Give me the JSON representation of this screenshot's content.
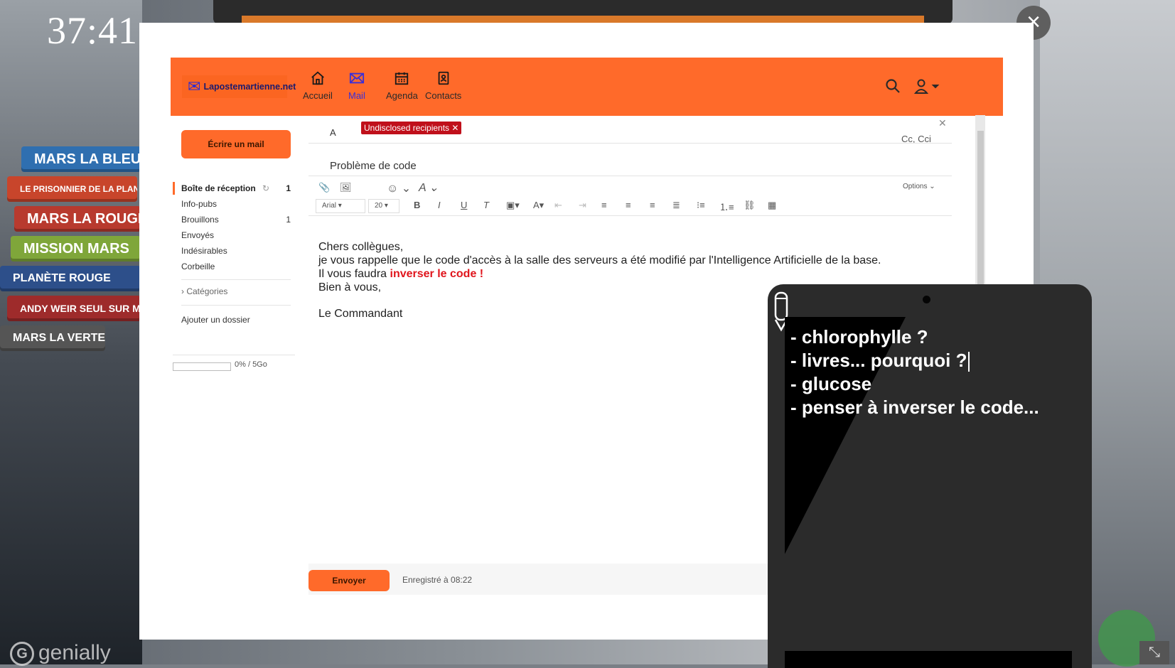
{
  "timer": "37:41",
  "close_label": "×",
  "background": {
    "books": [
      "MARS LA BLEUE",
      "LE PRISONNIER DE LA PLANÈTE MARS",
      "MARS LA ROUGE",
      "MISSION MARS",
      "PLANÈTE ROUGE",
      "ANDY WEIR SEUL SUR MARS",
      "MARS LA VERTE"
    ],
    "watermark": "genially"
  },
  "header": {
    "logo_text": "Lapostemartienne.net",
    "nav": [
      {
        "label": "Accueil",
        "icon": "home-icon"
      },
      {
        "label": "Mail",
        "icon": "mail-icon"
      },
      {
        "label": "Agenda",
        "icon": "calendar-icon"
      },
      {
        "label": "Contacts",
        "icon": "contacts-icon"
      }
    ],
    "accent": "#ff6a2a"
  },
  "sidebar": {
    "compose_label": "Écrire un mail",
    "folders": [
      {
        "label": "Boîte de réception",
        "count": "1"
      },
      {
        "label": "Info-pubs",
        "count": ""
      },
      {
        "label": "Brouillons",
        "count": "1"
      },
      {
        "label": "Envoyés",
        "count": ""
      },
      {
        "label": "Indésirables",
        "count": ""
      },
      {
        "label": "Corbeille",
        "count": ""
      }
    ],
    "categories_label": "Catégories",
    "add_folder_label": "Ajouter un dossier",
    "quota_text": "0% / 5Go",
    "quota_used": 0
  },
  "compose": {
    "to_label": "A",
    "recipient": "Undisclosed recipients",
    "cc_label": "Cc, Cci",
    "subject": "Problème de code",
    "options_label": "Options",
    "font_family": "Arial",
    "font_size": "20",
    "body": {
      "line1": " Chers collègues,",
      "line2": "je vous rappelle que le code d'accès à la salle des serveurs a été modifié par l'Intelligence Artificielle de la base.",
      "line3_prefix": "Il vous faudra ",
      "line3_emphasis": "inverser le code !",
      "line4": "Bien à vous,",
      "signature": "Le Commandant"
    },
    "send_label": "Envoyer",
    "saved_text": "Enregistré à 08:22"
  },
  "tablet_notes": [
    "- chlorophylle ?",
    "- livres... pourquoi ?",
    "- glucose",
    "- penser à inverser le code..."
  ]
}
